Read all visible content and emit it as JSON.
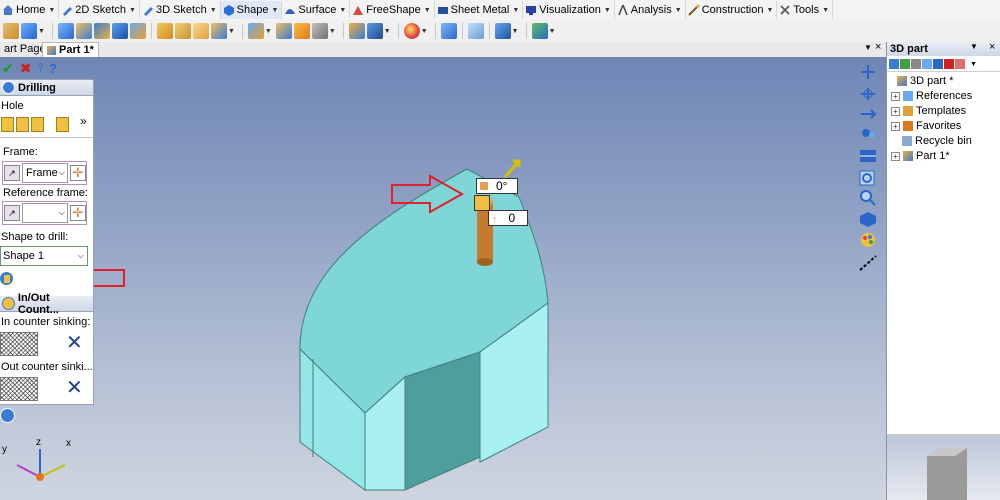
{
  "menu": {
    "tabs": [
      {
        "label": "Home",
        "icon": "home-icon",
        "color": "#4a78c8"
      },
      {
        "label": "2D Sketch",
        "icon": "pencil-icon",
        "color": "#3a7bd5"
      },
      {
        "label": "3D Sketch",
        "icon": "pencil-3d-icon",
        "color": "#3a7bd5"
      },
      {
        "label": "Shape",
        "icon": "cube-icon",
        "color": "#2b6fd6",
        "active": true
      },
      {
        "label": "Surface",
        "icon": "surface-icon",
        "color": "#3060c0"
      },
      {
        "label": "FreeShape",
        "icon": "freeshape-icon",
        "color": "#d24a3a"
      },
      {
        "label": "Sheet Metal",
        "icon": "sheet-metal-icon",
        "color": "#2a4f9a"
      },
      {
        "label": "Visualization",
        "icon": "monitor-icon",
        "color": "#2b3ea8"
      },
      {
        "label": "Analysis",
        "icon": "compass-icon",
        "color": "#444444"
      },
      {
        "label": "Construction",
        "icon": "wand-icon",
        "color": "#7a5a20"
      },
      {
        "label": "Tools",
        "icon": "tools-icon",
        "color": "#555555"
      }
    ]
  },
  "doc_tabs": {
    "start_page": "art Page",
    "part": "Part 1*"
  },
  "left_panel": {
    "drilling_title": "Drilling",
    "hole_label": "Hole",
    "more_glyph": "»",
    "frame_label": "Frame:",
    "frame_value": "Frame",
    "reference_frame_label": "Reference frame:",
    "reference_frame_value": "",
    "shape_label": "Shape to drill:",
    "shape_value": "Shape 1",
    "counter_title": "In/Out Count...",
    "in_counter_label": "In counter sinking:",
    "out_counter_label": "Out  counter sinki..."
  },
  "model": {
    "angle_value": "0°",
    "depth_value": "0",
    "colors": {
      "top": "#7fd6d6",
      "front": "#a9f0f0",
      "notch": "#4f9e9e",
      "cylinder": "#c77a2e"
    }
  },
  "right_panel": {
    "title": "3D part",
    "tree": [
      {
        "label": "3D part *",
        "icon": "part-icon",
        "expander": ""
      },
      {
        "label": "References",
        "icon": "references-icon",
        "expander": "+"
      },
      {
        "label": "Templates",
        "icon": "templates-icon",
        "expander": "+"
      },
      {
        "label": "Favorites",
        "icon": "favorites-icon",
        "expander": "+"
      },
      {
        "label": "Recycle bin",
        "icon": "recycle-bin-icon",
        "expander": ""
      },
      {
        "label": "Part 1*",
        "icon": "part-icon",
        "expander": "+"
      }
    ]
  },
  "axis": {
    "x": "x",
    "y": "y",
    "z": "z"
  }
}
